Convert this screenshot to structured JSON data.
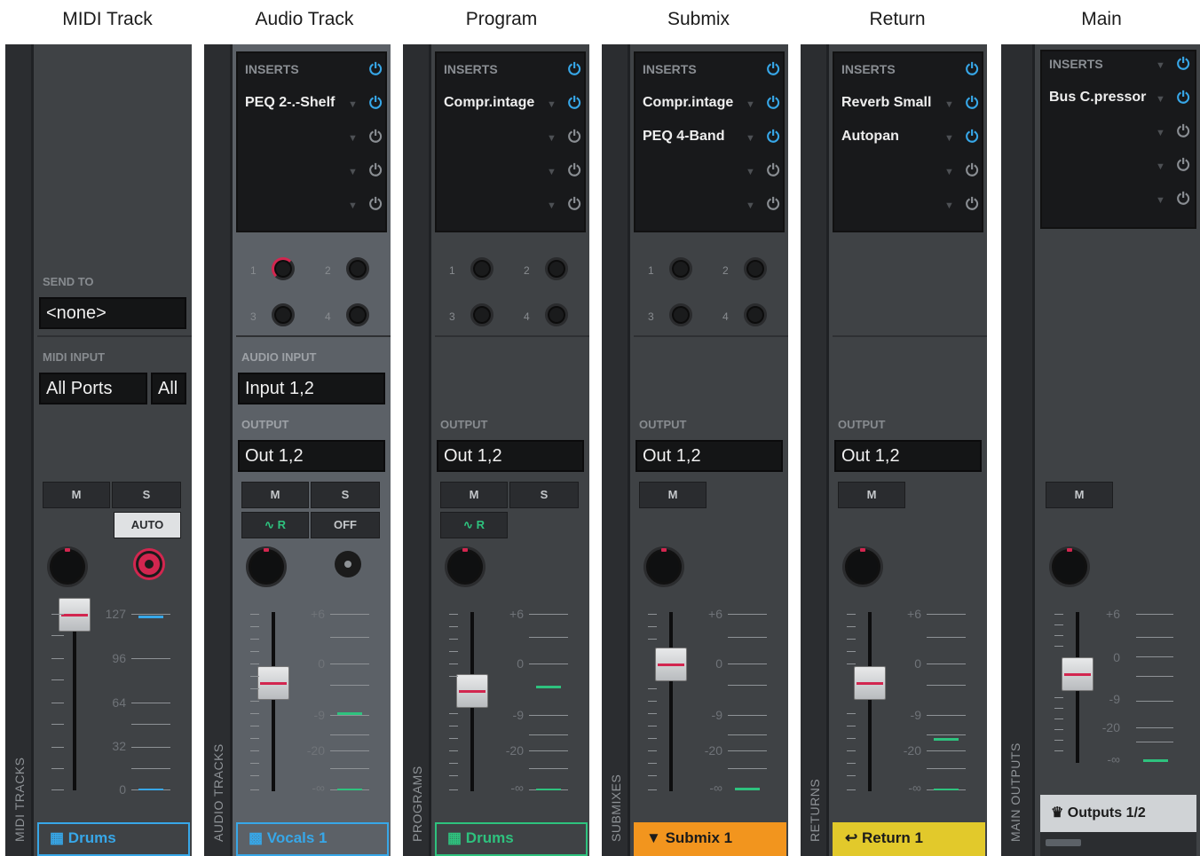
{
  "columns": [
    "MIDI Track",
    "Audio Track",
    "Program",
    "Submix",
    "Return",
    "Main"
  ],
  "colors": {
    "blue": "#37a7e8",
    "green": "#2ec27e",
    "orange": "#f2951e",
    "yellow": "#e2c92b",
    "red": "#d2264f"
  },
  "labels": {
    "inserts": "INSERTS",
    "send_to": "SEND TO",
    "midi_input": "MIDI INPUT",
    "audio_input": "AUDIO INPUT",
    "output": "OUTPUT",
    "mute": "M",
    "solo": "S",
    "auto": "AUTO",
    "off": "OFF",
    "automation_read": "R"
  },
  "rails": [
    "MIDI TRACKS",
    "AUDIO TRACKS",
    "PROGRAMS",
    "SUBMIXES",
    "RETURNS",
    "MAIN OUTPUTS"
  ],
  "send_numbers": [
    "1",
    "2",
    "3",
    "4"
  ],
  "midi_scale": [
    "127",
    "96",
    "64",
    "32",
    "0"
  ],
  "audio_scale": [
    "+6",
    "0",
    "-9",
    "-20",
    "-∞"
  ],
  "midi": {
    "send_to": "<none>",
    "midi_input_port": "All Ports",
    "midi_input_channel": "All",
    "footer": "Drums",
    "footer_icon": "grid-icon"
  },
  "audio": {
    "insert1": "PEQ 2-.-Shelf",
    "audio_input": "Input 1,2",
    "output": "Out 1,2",
    "footer": "Vocals 1",
    "footer_icon": "audio-icon"
  },
  "program": {
    "insert1": "Compr.intage",
    "output": "Out 1,2",
    "footer": "Drums",
    "footer_icon": "grid-icon"
  },
  "submix": {
    "insert1": "Compr.intage",
    "insert2": "PEQ 4-Band",
    "output": "Out 1,2",
    "footer": "Submix 1",
    "footer_icon": "submix-icon"
  },
  "return": {
    "insert1": "Reverb Small",
    "insert2": "Autopan",
    "output": "Out 1,2",
    "footer": "Return 1",
    "footer_icon": "return-icon"
  },
  "main": {
    "insert1": "Bus C.pressor",
    "footer": "Outputs 1/2",
    "footer_icon": "crown-icon"
  }
}
